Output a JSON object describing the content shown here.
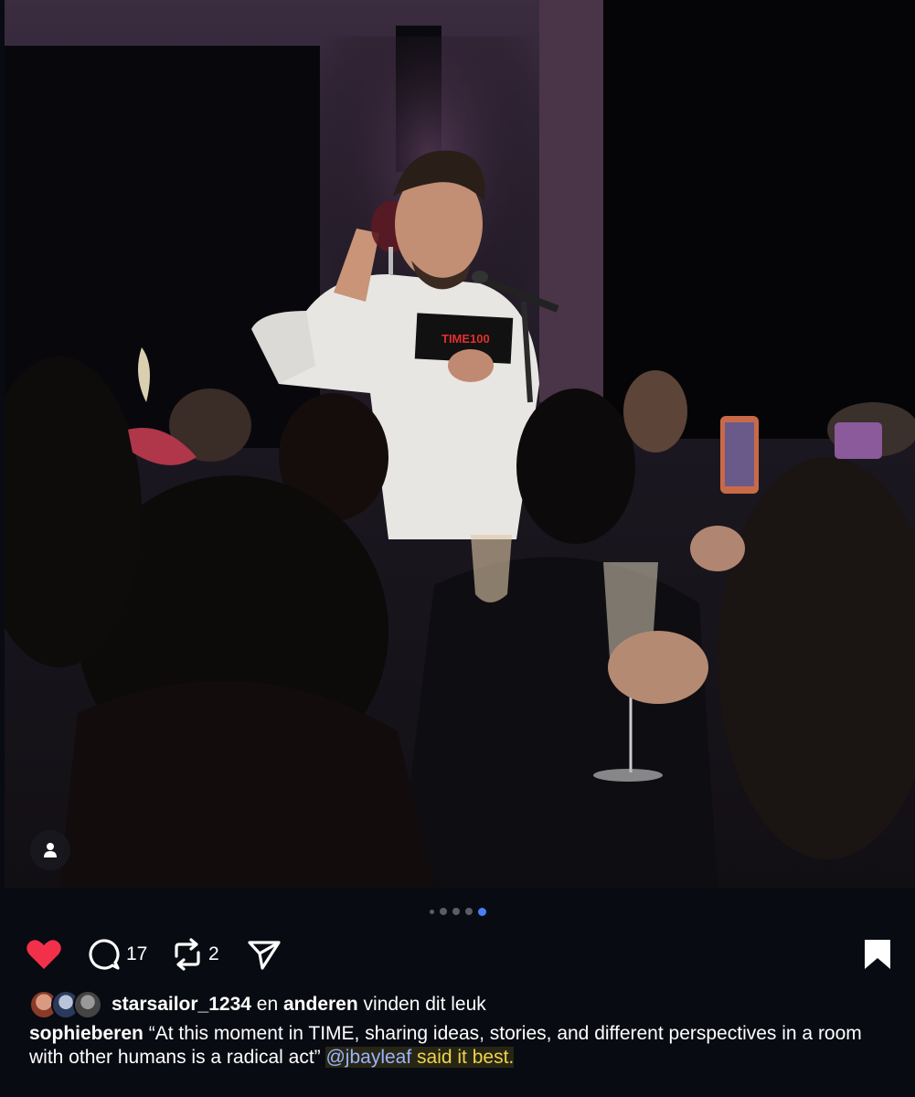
{
  "post": {
    "image_alt": "Man in white shirt raising a glass of red wine and speaking at a microphone at a TIME100 dinner",
    "card_text": "TIME100",
    "carousel": {
      "total": 5,
      "active_index": 4
    }
  },
  "actions": {
    "comment_count": "17",
    "repost_count": "2"
  },
  "likes": {
    "first_user": "starsailor_1234",
    "connector": " en ",
    "others": "anderen",
    "suffix": " vinden dit leuk"
  },
  "caption": {
    "username": "sophieberen",
    "text": " “At this moment in TIME, sharing ideas, stories, and different perspectives in a room with other humans is a radical act” ",
    "mention": "@jbayleaf",
    "highlight": " said it best."
  },
  "colors": {
    "background": "#090b12",
    "like_red": "#f2304a",
    "active_dot": "#4a7ef5",
    "highlight_yellow": "#f0d34a"
  },
  "icons": [
    "heart-icon",
    "comment-icon",
    "repost-icon",
    "share-icon",
    "bookmark-icon",
    "person-icon"
  ]
}
